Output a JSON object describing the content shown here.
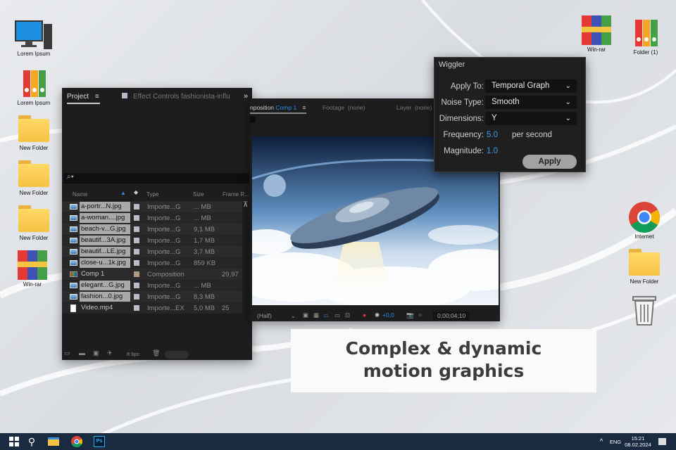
{
  "desktop": {
    "left_icons": [
      {
        "label": "Lorem Ipsum",
        "icon": "computer-icon"
      },
      {
        "label": "Lorem Ipsum",
        "icon": "binders-icon"
      },
      {
        "label": "New Folder",
        "icon": "folder-icon"
      },
      {
        "label": "New Folder",
        "icon": "folder-icon"
      },
      {
        "label": "New Folder",
        "icon": "folder-icon"
      },
      {
        "label": "Win-rar",
        "icon": "winrar-icon"
      }
    ],
    "right_icons": [
      {
        "label": "Win-rar",
        "icon": "winrar-icon"
      },
      {
        "label": "Folder (1)",
        "icon": "binders-icon"
      },
      {
        "label": "Internet",
        "icon": "chrome-icon"
      },
      {
        "label": "New Folder",
        "icon": "folder-icon"
      },
      {
        "label": "",
        "icon": "recycle-bin-icon"
      }
    ]
  },
  "project": {
    "tab": "Project",
    "effect_tab": "Effect Controls fashionista-influ",
    "columns": {
      "name": "Name",
      "type": "Type",
      "size": "Size",
      "frame": "Frame R..."
    },
    "rows": [
      {
        "name": "a-portr...N.jpg",
        "type": "Importe...G",
        "size": "... MB",
        "frame": ""
      },
      {
        "name": "a-woman....jpg",
        "type": "Importe...G",
        "size": "... MB",
        "frame": ""
      },
      {
        "name": "beach-v...G.jpg",
        "type": "Importe...G",
        "size": "9,1 MB",
        "frame": ""
      },
      {
        "name": "beautif...3A.jpg",
        "type": "Importe...G",
        "size": "1,7 MB",
        "frame": ""
      },
      {
        "name": "beautif...LE.jpg",
        "type": "Importe...G",
        "size": "3,7 MB",
        "frame": ""
      },
      {
        "name": "close-u...1k.jpg",
        "type": "Importe...G",
        "size": "859 KB",
        "frame": ""
      },
      {
        "name": "Comp 1",
        "type": "Composition",
        "size": "",
        "frame": "29,97"
      },
      {
        "name": "elegant...G.jpg",
        "type": "Importe...G",
        "size": "... MB",
        "frame": ""
      },
      {
        "name": "fashion...0.jpg",
        "type": "Importe...G",
        "size": "8,3 MB",
        "frame": ""
      },
      {
        "name": "Video.mp4",
        "type": "Importe...EX",
        "size": "5,0 MB",
        "frame": "25"
      }
    ],
    "bpc": "8 bpc"
  },
  "composition": {
    "tab_prefix": "nposition",
    "tab_name": "Comp 1",
    "footage": "Footage  (none)",
    "layer": "Layer  (none)",
    "resolution": "(Half)",
    "exposure": "+0,0",
    "timecode": "0;00;04;10"
  },
  "wiggler": {
    "title": "Wiggler",
    "apply_to_label": "Apply To:",
    "apply_to": "Temporal Graph",
    "noise_label": "Noise Type:",
    "noise": "Smooth",
    "dimensions_label": "Dimensions:",
    "dimensions": "Y",
    "frequency_label": "Frequency:",
    "frequency": "5.0",
    "frequency_unit": "per second",
    "magnitude_label": "Magnitude:",
    "magnitude": "1.0",
    "apply_button": "Apply"
  },
  "caption": {
    "line1": "Complex & dynamic",
    "line2": "motion graphics"
  },
  "taskbar": {
    "language": "ENG",
    "time": "15:21",
    "date": "08.02.2024"
  }
}
